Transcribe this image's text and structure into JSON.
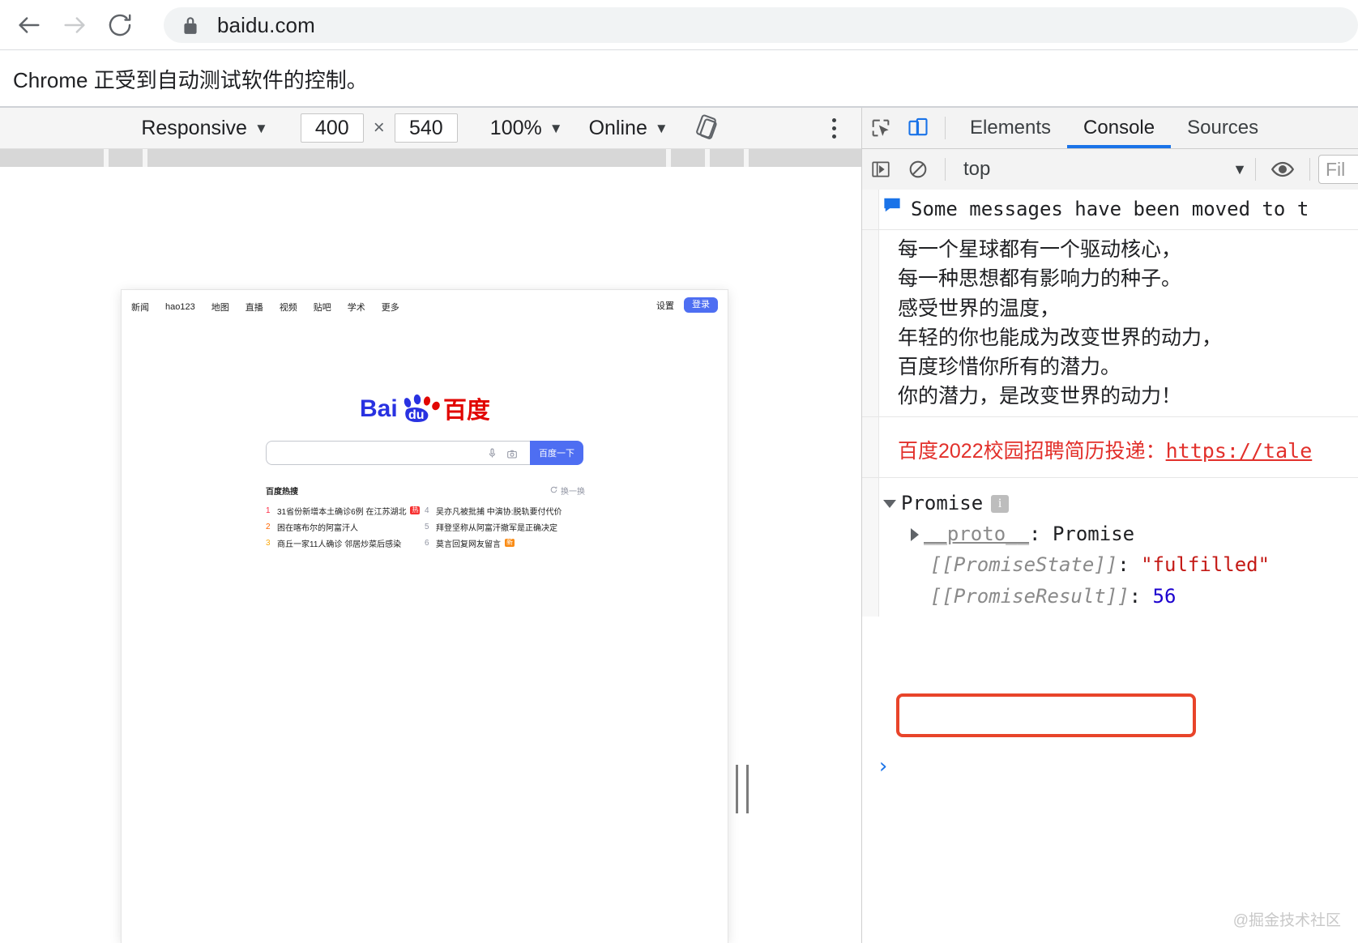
{
  "browser": {
    "url": "baidu.com",
    "back_icon": "back-arrow-icon",
    "forward_icon": "forward-arrow-icon",
    "reload_icon": "reload-icon",
    "lock_icon": "lock-icon",
    "infobar_text": "Chrome 正受到自动测试软件的控制。"
  },
  "device_toolbar": {
    "device": "Responsive",
    "width": "400",
    "height": "540",
    "separator": "×",
    "zoom": "100%",
    "throttling": "Online",
    "rotate_icon": "rotate-device-icon",
    "more_icon": "more-options-icon"
  },
  "devtools": {
    "inspect_icon": "inspect-element-icon",
    "device_toggle_icon": "toggle-device-toolbar-icon",
    "tabs": [
      {
        "label": "Elements",
        "selected": false
      },
      {
        "label": "Console",
        "selected": true
      },
      {
        "label": "Sources",
        "selected": false
      }
    ],
    "console_toolbar": {
      "sidebar_icon": "console-sidebar-icon",
      "clear_icon": "clear-console-icon",
      "context": "top",
      "context_caret": "▼",
      "eye_icon": "live-expression-eye-icon",
      "filter_placeholder": "Fil"
    },
    "messages": {
      "info_banner": {
        "icon": "info-message-icon",
        "text": "Some messages have been moved to t"
      },
      "poem_lines": [
        "每一个星球都有一个驱动核心，",
        "每一种思想都有影响力的种子。",
        "感受世界的温度，",
        "年轻的你也能成为改变世界的动力，",
        "百度珍惜你所有的潜力。",
        "你的潜力，是改变世界的动力！"
      ],
      "recruit": {
        "label": "百度2022校园招聘简历投递：",
        "link": "https://tale"
      },
      "promise": {
        "expander": "▼",
        "title": "Promise",
        "info_badge": "i",
        "proto_expander": "▶",
        "proto_key": "__proto__",
        "proto_value": "Promise",
        "state_key": "[[PromiseState]]",
        "state_value": "\"fulfilled\"",
        "result_key": "[[PromiseResult]]",
        "result_value": "56"
      },
      "prompt_caret": "›"
    },
    "highlight_color": "#e8442a"
  },
  "baidu": {
    "nav_left": [
      "新闻",
      "hao123",
      "地图",
      "直播",
      "视频",
      "贴吧",
      "学术",
      "更多"
    ],
    "settings": "设置",
    "login": "登录",
    "logo_alt": "Bai度 百度",
    "search_value": "",
    "mic_icon": "microphone-icon",
    "camera_icon": "camera-icon",
    "search_button": "百度一下",
    "hot_title": "百度热搜",
    "refresh_label": "换一换",
    "refresh_icon": "refresh-icon",
    "hot_items_left": [
      {
        "rank": "1",
        "text": "31省份新增本土确诊6例 在江苏湖北",
        "tag": "热",
        "tag_type": "hot"
      },
      {
        "rank": "2",
        "text": "困在喀布尔的阿富汗人",
        "tag": "",
        "tag_type": ""
      },
      {
        "rank": "3",
        "text": "商丘一家11人确诊 邻居炒菜后感染",
        "tag": "",
        "tag_type": ""
      }
    ],
    "hot_items_right": [
      {
        "rank": "4",
        "text": "吴亦凡被批捕 中演协:脱轨要付代价",
        "tag": "",
        "tag_type": ""
      },
      {
        "rank": "5",
        "text": "拜登坚称从阿富汗撤军是正确决定",
        "tag": "",
        "tag_type": ""
      },
      {
        "rank": "6",
        "text": "莫言回复网友留言",
        "tag": "新",
        "tag_type": "new"
      }
    ]
  },
  "watermark": "@掘金技术社区"
}
